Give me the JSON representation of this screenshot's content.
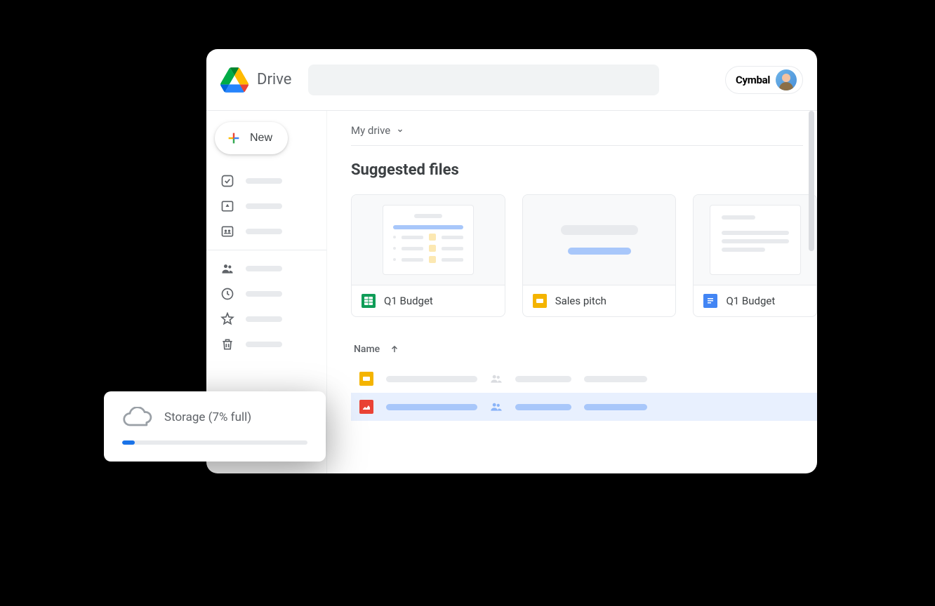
{
  "header": {
    "app_title": "Drive",
    "brand": "Cymbal"
  },
  "sidebar": {
    "new_label": "New"
  },
  "breadcrumb": {
    "label": "My drive"
  },
  "suggested": {
    "title": "Suggested files",
    "cards": [
      {
        "name": "Q1 Budget",
        "type": "sheets"
      },
      {
        "name": "Sales pitch",
        "type": "slides"
      },
      {
        "name": "Q1 Budget",
        "type": "docs"
      }
    ]
  },
  "list": {
    "header_name": "Name",
    "sort_direction": "asc"
  },
  "storage": {
    "label": "Storage (7% full)",
    "percent": 7
  }
}
